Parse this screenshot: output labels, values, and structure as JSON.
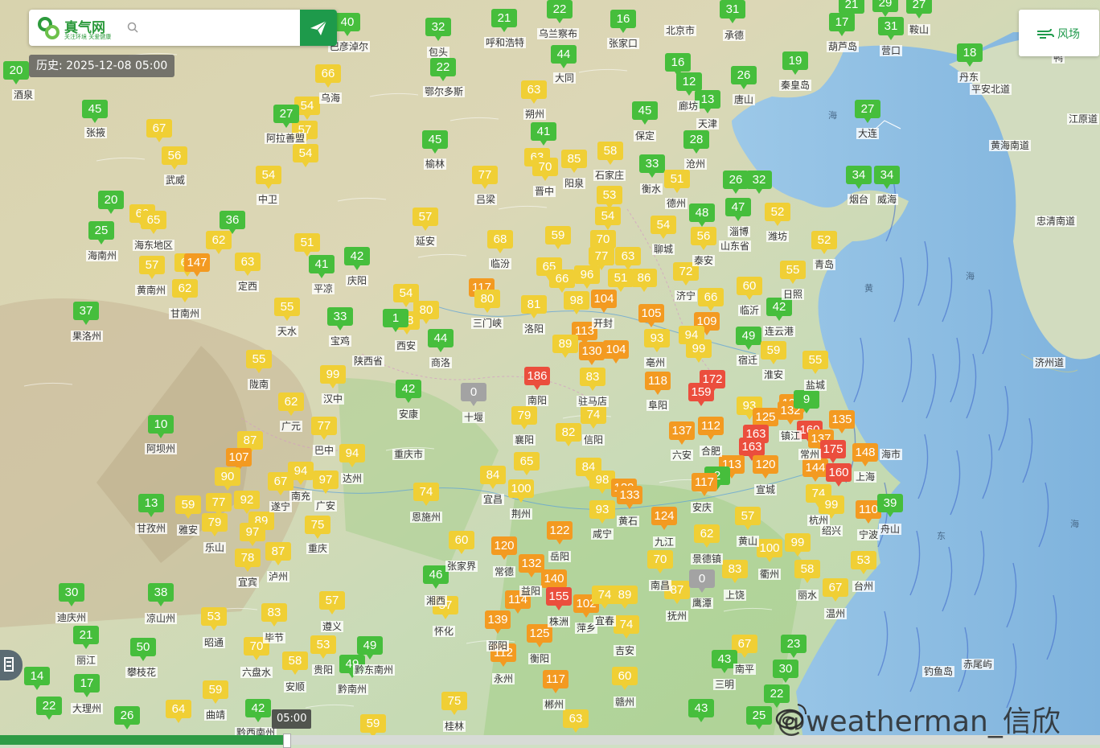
{
  "app": {
    "name": "真气网",
    "tagline": "关注环境 关爱健康"
  },
  "search": {
    "placeholder": ""
  },
  "history_label": "历史: 2025-12-08 05:00",
  "wind_toggle_label": "风场",
  "timeline": {
    "tooltip": "05:00",
    "progress": 0.26
  },
  "watermark": "@weatherman_信欣",
  "colors": {
    "good": "#46be3c",
    "moderate": "#f0cf35",
    "sensitive": "#f39a21",
    "unhealthy": "#eb4e3d",
    "none": "#a3a3a3",
    "brand": "#1e9a4b"
  },
  "icons": [
    "logo-icon",
    "search-icon",
    "send-icon",
    "wind-icon",
    "tool-icon",
    "weibo-icon"
  ],
  "markers": [
    [
      20,
      100,
      20
    ],
    [
      118,
      148,
      45
    ],
    [
      198,
      172,
      67
    ],
    [
      217,
      206,
      56
    ],
    [
      334,
      230,
      54
    ],
    [
      382,
      144,
      54
    ],
    [
      379,
      174,
      57
    ],
    [
      380,
      203,
      54
    ],
    [
      356,
      154,
      27
    ],
    [
      432,
      40,
      40
    ],
    [
      408,
      104,
      66
    ],
    [
      545,
      46,
      32
    ],
    [
      551,
      96,
      22
    ],
    [
      627,
      35,
      21
    ],
    [
      696,
      24,
      22
    ],
    [
      775,
      36,
      16
    ],
    [
      911,
      24,
      31
    ],
    [
      1059,
      18,
      21
    ],
    [
      1101,
      16,
      29
    ],
    [
      1143,
      18,
      27
    ],
    [
      1047,
      40,
      17
    ],
    [
      1108,
      45,
      31
    ],
    [
      1206,
      78,
      18
    ],
    [
      989,
      88,
      19
    ],
    [
      843,
      90,
      16
    ],
    [
      857,
      114,
      12
    ],
    [
      925,
      106,
      26
    ],
    [
      880,
      136,
      13
    ],
    [
      1079,
      148,
      27
    ],
    [
      866,
      186,
      28
    ],
    [
      701,
      80,
      44
    ],
    [
      664,
      124,
      63
    ],
    [
      676,
      176,
      41
    ],
    [
      668,
      208,
      63
    ],
    [
      678,
      220,
      70
    ],
    [
      714,
      210,
      85
    ],
    [
      759,
      200,
      58
    ],
    [
      811,
      216,
      33
    ],
    [
      842,
      235,
      51
    ],
    [
      802,
      150,
      45
    ],
    [
      541,
      186,
      45
    ],
    [
      603,
      230,
      77
    ],
    [
      758,
      255,
      53
    ],
    [
      756,
      281,
      54
    ],
    [
      750,
      310,
      70
    ],
    [
      748,
      331,
      77
    ],
    [
      781,
      331,
      63
    ],
    [
      825,
      292,
      54
    ],
    [
      873,
      277,
      48
    ],
    [
      875,
      306,
      56
    ],
    [
      915,
      236,
      26
    ],
    [
      944,
      236,
      32
    ],
    [
      918,
      270,
      47
    ],
    [
      967,
      276,
      52
    ],
    [
      1025,
      311,
      52
    ],
    [
      1068,
      230,
      34
    ],
    [
      1103,
      230,
      34
    ],
    [
      529,
      282,
      57
    ],
    [
      622,
      310,
      68
    ],
    [
      694,
      305,
      59
    ],
    [
      683,
      344,
      65
    ],
    [
      699,
      359,
      66
    ],
    [
      730,
      354,
      96
    ],
    [
      772,
      358,
      51
    ],
    [
      801,
      358,
      86
    ],
    [
      853,
      350,
      72
    ],
    [
      884,
      382,
      66
    ],
    [
      932,
      368,
      60
    ],
    [
      969,
      394,
      42
    ],
    [
      986,
      348,
      55
    ],
    [
      599,
      370,
      117
    ],
    [
      606,
      384,
      80
    ],
    [
      664,
      391,
      81
    ],
    [
      717,
      386,
      98
    ],
    [
      751,
      384,
      104
    ],
    [
      810,
      402,
      105
    ],
    [
      879,
      412,
      109
    ],
    [
      860,
      429,
      94
    ],
    [
      817,
      433,
      93
    ],
    [
      869,
      446,
      99
    ],
    [
      931,
      430,
      49
    ],
    [
      962,
      448,
      59
    ],
    [
      1014,
      460,
      55
    ],
    [
      530,
      398,
      80
    ],
    [
      506,
      411,
      88
    ],
    [
      492,
      408,
      1
    ],
    [
      505,
      377,
      54
    ],
    [
      548,
      433,
      44
    ],
    [
      423,
      406,
      33
    ],
    [
      357,
      394,
      55
    ],
    [
      233,
      339,
      62
    ],
    [
      230,
      371,
      62
    ],
    [
      189,
      342,
      57
    ],
    [
      245,
      339,
      147
    ],
    [
      308,
      338,
      63
    ],
    [
      400,
      341,
      41
    ],
    [
      444,
      331,
      42
    ],
    [
      272,
      311,
      62
    ],
    [
      382,
      314,
      51
    ],
    [
      289,
      286,
      36
    ],
    [
      138,
      261,
      20
    ],
    [
      177,
      278,
      60
    ],
    [
      191,
      286,
      65
    ],
    [
      126,
      299,
      25
    ],
    [
      107,
      399,
      37
    ],
    [
      727,
      424,
      113
    ],
    [
      736,
      449,
      130
    ],
    [
      766,
      447,
      104
    ],
    [
      703,
      440,
      89
    ],
    [
      737,
      481,
      83
    ],
    [
      668,
      480,
      186
    ],
    [
      886,
      484,
      172
    ],
    [
      872,
      500,
      159
    ],
    [
      818,
      486,
      118
    ],
    [
      589,
      500,
      0
    ],
    [
      508,
      496,
      42
    ],
    [
      652,
      529,
      79
    ],
    [
      738,
      528,
      74
    ],
    [
      707,
      550,
      82
    ],
    [
      848,
      548,
      137
    ],
    [
      884,
      542,
      112
    ],
    [
      932,
      517,
      93
    ],
    [
      952,
      531,
      125
    ],
    [
      985,
      514,
      133
    ],
    [
      983,
      523,
      132
    ],
    [
      1003,
      509,
      9
    ],
    [
      1007,
      547,
      160
    ],
    [
      1047,
      534,
      135
    ],
    [
      1021,
      558,
      137
    ],
    [
      940,
      552,
      163
    ],
    [
      935,
      568,
      163
    ],
    [
      1036,
      571,
      175
    ],
    [
      1076,
      575,
      148
    ],
    [
      1014,
      594,
      144
    ],
    [
      1043,
      600,
      160
    ],
    [
      910,
      590,
      113
    ],
    [
      952,
      590,
      120
    ],
    [
      892,
      604,
      2
    ],
    [
      876,
      612,
      117
    ],
    [
      414,
      478,
      99
    ],
    [
      362,
      512,
      62
    ],
    [
      403,
      542,
      77
    ],
    [
      438,
      576,
      94
    ],
    [
      374,
      598,
      94
    ],
    [
      405,
      609,
      97
    ],
    [
      349,
      611,
      67
    ],
    [
      311,
      560,
      87
    ],
    [
      297,
      581,
      107
    ],
    [
      283,
      605,
      90
    ],
    [
      322,
      459,
      55
    ],
    [
      200,
      540,
      10
    ],
    [
      188,
      638,
      13
    ],
    [
      234,
      640,
      59
    ],
    [
      272,
      637,
      77
    ],
    [
      307,
      634,
      92
    ],
    [
      325,
      660,
      89
    ],
    [
      314,
      674,
      97
    ],
    [
      267,
      662,
      79
    ],
    [
      395,
      665,
      75
    ],
    [
      346,
      698,
      87
    ],
    [
      308,
      706,
      78
    ],
    [
      655,
      586,
      65
    ],
    [
      613,
      603,
      84
    ],
    [
      648,
      620,
      100
    ],
    [
      732,
      593,
      84
    ],
    [
      749,
      609,
      98
    ],
    [
      776,
      619,
      129
    ],
    [
      783,
      628,
      133
    ],
    [
      749,
      646,
      93
    ],
    [
      826,
      654,
      124
    ],
    [
      879,
      676,
      62
    ],
    [
      930,
      654,
      57
    ],
    [
      530,
      624,
      74
    ],
    [
      574,
      684,
      60
    ],
    [
      627,
      691,
      120
    ],
    [
      661,
      713,
      132
    ],
    [
      696,
      672,
      122
    ],
    [
      689,
      732,
      140
    ],
    [
      695,
      754,
      155
    ],
    [
      644,
      758,
      114
    ],
    [
      729,
      763,
      102
    ],
    [
      752,
      752,
      74
    ],
    [
      777,
      752,
      89
    ],
    [
      779,
      789,
      74
    ],
    [
      619,
      783,
      139
    ],
    [
      671,
      800,
      125
    ],
    [
      626,
      824,
      112
    ],
    [
      691,
      857,
      117
    ],
    [
      542,
      727,
      46
    ],
    [
      554,
      765,
      57
    ],
    [
      777,
      853,
      60
    ],
    [
      821,
      708,
      70
    ],
    [
      842,
      746,
      87
    ],
    [
      873,
      732,
      0
    ],
    [
      914,
      720,
      83
    ],
    [
      957,
      694,
      100
    ],
    [
      992,
      687,
      99
    ],
    [
      1004,
      720,
      58
    ],
    [
      1039,
      743,
      67
    ],
    [
      1074,
      709,
      53
    ],
    [
      1018,
      626,
      74
    ],
    [
      1034,
      640,
      99
    ],
    [
      1080,
      646,
      110
    ],
    [
      1107,
      638,
      39
    ],
    [
      89,
      749,
      30
    ],
    [
      200,
      749,
      38
    ],
    [
      107,
      802,
      21
    ],
    [
      178,
      817,
      50
    ],
    [
      266,
      779,
      53
    ],
    [
      341,
      774,
      83
    ],
    [
      413,
      759,
      57
    ],
    [
      319,
      816,
      70
    ],
    [
      402,
      814,
      53
    ],
    [
      367,
      834,
      58
    ],
    [
      438,
      838,
      49
    ],
    [
      460,
      815,
      49
    ],
    [
      268,
      870,
      59
    ],
    [
      222,
      894,
      64
    ],
    [
      46,
      853,
      14
    ],
    [
      108,
      862,
      17
    ],
    [
      61,
      890,
      22
    ],
    [
      158,
      902,
      26
    ],
    [
      321,
      893,
      42
    ],
    [
      565,
      884,
      75
    ],
    [
      464,
      912,
      59
    ],
    [
      716,
      906,
      63
    ],
    [
      926,
      813,
      67
    ],
    [
      987,
      813,
      23
    ],
    [
      901,
      832,
      43
    ],
    [
      977,
      844,
      30
    ],
    [
      966,
      875,
      22
    ],
    [
      872,
      893,
      43
    ],
    [
      944,
      902,
      25
    ]
  ],
  "cities": [
    [
      29,
      119,
      "酒泉"
    ],
    [
      119,
      166,
      "张掖"
    ],
    [
      218,
      225,
      "武威"
    ],
    [
      333,
      249,
      "中卫"
    ],
    [
      355,
      173,
      "阿拉善盟"
    ],
    [
      411,
      123,
      "乌海"
    ],
    [
      434,
      59,
      "巴彦淖尔"
    ],
    [
      545,
      66,
      "包头"
    ],
    [
      552,
      115,
      "鄂尔多斯"
    ],
    [
      628,
      54,
      "呼和浩特"
    ],
    [
      694,
      43,
      "乌兰察布"
    ],
    [
      775,
      55,
      "张家口"
    ],
    [
      846,
      39,
      "北京市"
    ],
    [
      913,
      45,
      "承德"
    ],
    [
      1048,
      59,
      "葫芦岛"
    ],
    [
      1108,
      64,
      "营口"
    ],
    [
      1143,
      38,
      "鞍山"
    ],
    [
      1205,
      97,
      "丹东"
    ],
    [
      989,
      107,
      "秦皇岛"
    ],
    [
      925,
      125,
      "唐山"
    ],
    [
      856,
      133,
      "廊坊"
    ],
    [
      880,
      155,
      "天津"
    ],
    [
      1079,
      167,
      "大连"
    ],
    [
      865,
      205,
      "沧州"
    ],
    [
      702,
      98,
      "大同"
    ],
    [
      665,
      143,
      "朔州"
    ],
    [
      677,
      239,
      "晋中"
    ],
    [
      714,
      229,
      "阳泉"
    ],
    [
      758,
      219,
      "石家庄"
    ],
    [
      810,
      236,
      "衡水"
    ],
    [
      802,
      170,
      "保定"
    ],
    [
      841,
      254,
      "德州"
    ],
    [
      541,
      205,
      "榆林"
    ],
    [
      604,
      249,
      "吕梁"
    ],
    [
      529,
      301,
      "延安"
    ],
    [
      622,
      329,
      "临汾"
    ],
    [
      825,
      311,
      "聊城"
    ],
    [
      875,
      325,
      "泰安"
    ],
    [
      919,
      289,
      "淄博"
    ],
    [
      967,
      295,
      "潍坊"
    ],
    [
      1025,
      330,
      "青岛"
    ],
    [
      1068,
      249,
      "烟台"
    ],
    [
      1103,
      249,
      "威海"
    ],
    [
      914,
      307,
      "山东省"
    ],
    [
      853,
      369,
      "济宁"
    ],
    [
      932,
      387,
      "临沂"
    ],
    [
      986,
      367,
      "日照"
    ],
    [
      969,
      413,
      "连云港"
    ],
    [
      664,
      410,
      "洛阳"
    ],
    [
      606,
      403,
      "三门峡"
    ],
    [
      505,
      431,
      "西安"
    ],
    [
      548,
      452,
      "商洛"
    ],
    [
      423,
      425,
      "宝鸡"
    ],
    [
      458,
      450,
      "陕西省"
    ],
    [
      357,
      413,
      "天水"
    ],
    [
      402,
      360,
      "平凉"
    ],
    [
      444,
      350,
      "庆阳"
    ],
    [
      308,
      357,
      "定西"
    ],
    [
      230,
      391,
      "甘南州"
    ],
    [
      188,
      362,
      "黄南州"
    ],
    [
      127,
      319,
      "海南州"
    ],
    [
      191,
      306,
      "海东地区"
    ],
    [
      108,
      419,
      "果洛州"
    ],
    [
      750,
      403,
      "开封"
    ],
    [
      815,
      452,
      "亳州"
    ],
    [
      930,
      449,
      "宿迁"
    ],
    [
      962,
      467,
      "淮安"
    ],
    [
      1014,
      480,
      "盐城"
    ],
    [
      737,
      500,
      "驻马店"
    ],
    [
      668,
      499,
      "南阳"
    ],
    [
      589,
      520,
      "十堰"
    ],
    [
      508,
      516,
      "安康"
    ],
    [
      818,
      505,
      "阜阳"
    ],
    [
      652,
      548,
      "襄阳"
    ],
    [
      738,
      548,
      "信阳"
    ],
    [
      848,
      567,
      "六安"
    ],
    [
      884,
      562,
      "合肥"
    ],
    [
      983,
      543,
      "镇江"
    ],
    [
      1007,
      566,
      "常州"
    ],
    [
      1108,
      566,
      "海市"
    ],
    [
      1076,
      594,
      "上海"
    ],
    [
      952,
      610,
      "宣城"
    ],
    [
      873,
      632,
      "安庆"
    ],
    [
      414,
      497,
      "汉中"
    ],
    [
      362,
      531,
      "广元"
    ],
    [
      403,
      561,
      "巴中"
    ],
    [
      438,
      596,
      "达州"
    ],
    [
      508,
      566,
      "重庆市"
    ],
    [
      374,
      618,
      "南充"
    ],
    [
      405,
      630,
      "广安"
    ],
    [
      349,
      631,
      "遂宁"
    ],
    [
      322,
      479,
      "陇南"
    ],
    [
      200,
      559,
      "阿坝州"
    ],
    [
      188,
      658,
      "甘孜州"
    ],
    [
      234,
      660,
      "雅安"
    ],
    [
      267,
      682,
      "乐山"
    ],
    [
      395,
      683,
      "重庆"
    ],
    [
      346,
      718,
      "泸州"
    ],
    [
      308,
      725,
      "宜宾"
    ],
    [
      613,
      622,
      "宜昌"
    ],
    [
      648,
      640,
      "荆州"
    ],
    [
      749,
      665,
      "咸宁"
    ],
    [
      781,
      649,
      "黄石"
    ],
    [
      826,
      675,
      "九江"
    ],
    [
      879,
      696,
      "景德镇"
    ],
    [
      930,
      674,
      "黄山"
    ],
    [
      1018,
      648,
      "杭州"
    ],
    [
      1034,
      661,
      "绍兴"
    ],
    [
      1080,
      666,
      "宁波"
    ],
    [
      1107,
      659,
      "舟山"
    ],
    [
      530,
      644,
      "恩施州"
    ],
    [
      574,
      705,
      "张家界"
    ],
    [
      627,
      712,
      "常德"
    ],
    [
      696,
      693,
      "岳阳"
    ],
    [
      660,
      736,
      "益阳"
    ],
    [
      695,
      774,
      "株洲"
    ],
    [
      729,
      782,
      "萍乡"
    ],
    [
      752,
      773,
      "宜春"
    ],
    [
      777,
      810,
      "吉安"
    ],
    [
      619,
      804,
      "邵阳"
    ],
    [
      671,
      820,
      "衡阳"
    ],
    [
      626,
      845,
      "永州"
    ],
    [
      689,
      877,
      "郴州"
    ],
    [
      542,
      748,
      "湘西"
    ],
    [
      552,
      786,
      "怀化"
    ],
    [
      777,
      874,
      "赣州"
    ],
    [
      821,
      729,
      "南昌"
    ],
    [
      842,
      767,
      "抚州"
    ],
    [
      873,
      751,
      "鹰潭"
    ],
    [
      914,
      741,
      "上饶"
    ],
    [
      957,
      715,
      "衢州"
    ],
    [
      1004,
      741,
      "丽水"
    ],
    [
      1039,
      764,
      "温州"
    ],
    [
      1074,
      730,
      "台州"
    ],
    [
      89,
      769,
      "迪庆州"
    ],
    [
      200,
      770,
      "凉山州"
    ],
    [
      107,
      822,
      "丽江"
    ],
    [
      176,
      837,
      "攀枝花"
    ],
    [
      266,
      800,
      "昭通"
    ],
    [
      341,
      794,
      "毕节"
    ],
    [
      413,
      780,
      "遵义"
    ],
    [
      319,
      837,
      "六盘水"
    ],
    [
      402,
      834,
      "贵阳"
    ],
    [
      367,
      855,
      "安顺"
    ],
    [
      438,
      858,
      "黔南州"
    ],
    [
      465,
      834,
      "黔东南州"
    ],
    [
      268,
      890,
      "曲靖"
    ],
    [
      108,
      882,
      "大理州"
    ],
    [
      901,
      852,
      "三明"
    ],
    [
      926,
      833,
      "南平"
    ],
    [
      318,
      912,
      "黔西南州"
    ],
    [
      565,
      904,
      "桂林"
    ],
    [
      1165,
      666,
      "东"
    ],
    [
      1075,
      358,
      "黄"
    ],
    [
      1201,
      343,
      "海"
    ],
    [
      1030,
      143,
      "海"
    ],
    [
      1331,
      651,
      "海"
    ],
    [
      1232,
      112,
      "平安北道"
    ],
    [
      1316,
      73,
      "鸭"
    ],
    [
      1256,
      182,
      "黄海南道"
    ],
    [
      1347,
      149,
      "江原道"
    ],
    [
      1313,
      276,
      "忠清南道"
    ],
    [
      1305,
      452,
      "济州道"
    ],
    [
      1167,
      836,
      "钓鱼岛"
    ],
    [
      1216,
      827,
      "赤尾屿"
    ]
  ]
}
